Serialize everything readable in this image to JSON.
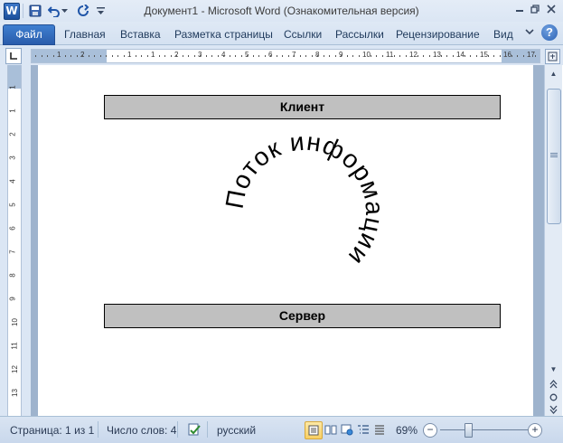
{
  "window": {
    "app_icon": "W",
    "title": "Документ1  -  Microsoft Word (Ознакомительная версия)"
  },
  "ribbon": {
    "file_tab": "Файл",
    "tabs": [
      "Главная",
      "Вставка",
      "Разметка страницы",
      "Ссылки",
      "Рассылки",
      "Рецензирование",
      "Вид"
    ],
    "help": "?"
  },
  "ruler": {
    "h_numbers": [
      "1",
      "2",
      "1",
      "1",
      "2",
      "3",
      "4",
      "5",
      "6",
      "7",
      "8",
      "9",
      "10",
      "11",
      "12",
      "13",
      "14",
      "15",
      "16",
      "17"
    ],
    "v_numbers": [
      "1",
      "1",
      "2",
      "3",
      "4",
      "5",
      "6",
      "7",
      "8",
      "9",
      "10",
      "11",
      "12",
      "13"
    ]
  },
  "document": {
    "top_box": "Клиент",
    "circle_text": "Поток информации",
    "bottom_box": "Сервер"
  },
  "status": {
    "page": "Страница: 1 из 1",
    "words": "Число слов: 4",
    "language": "русский",
    "zoom": "69%",
    "zoom_minus": "−",
    "zoom_plus": "+"
  },
  "colors": {
    "box_fill": "#c0c0c0",
    "file_tab": "#2a5cab",
    "workspace": "#9eb3cd"
  }
}
